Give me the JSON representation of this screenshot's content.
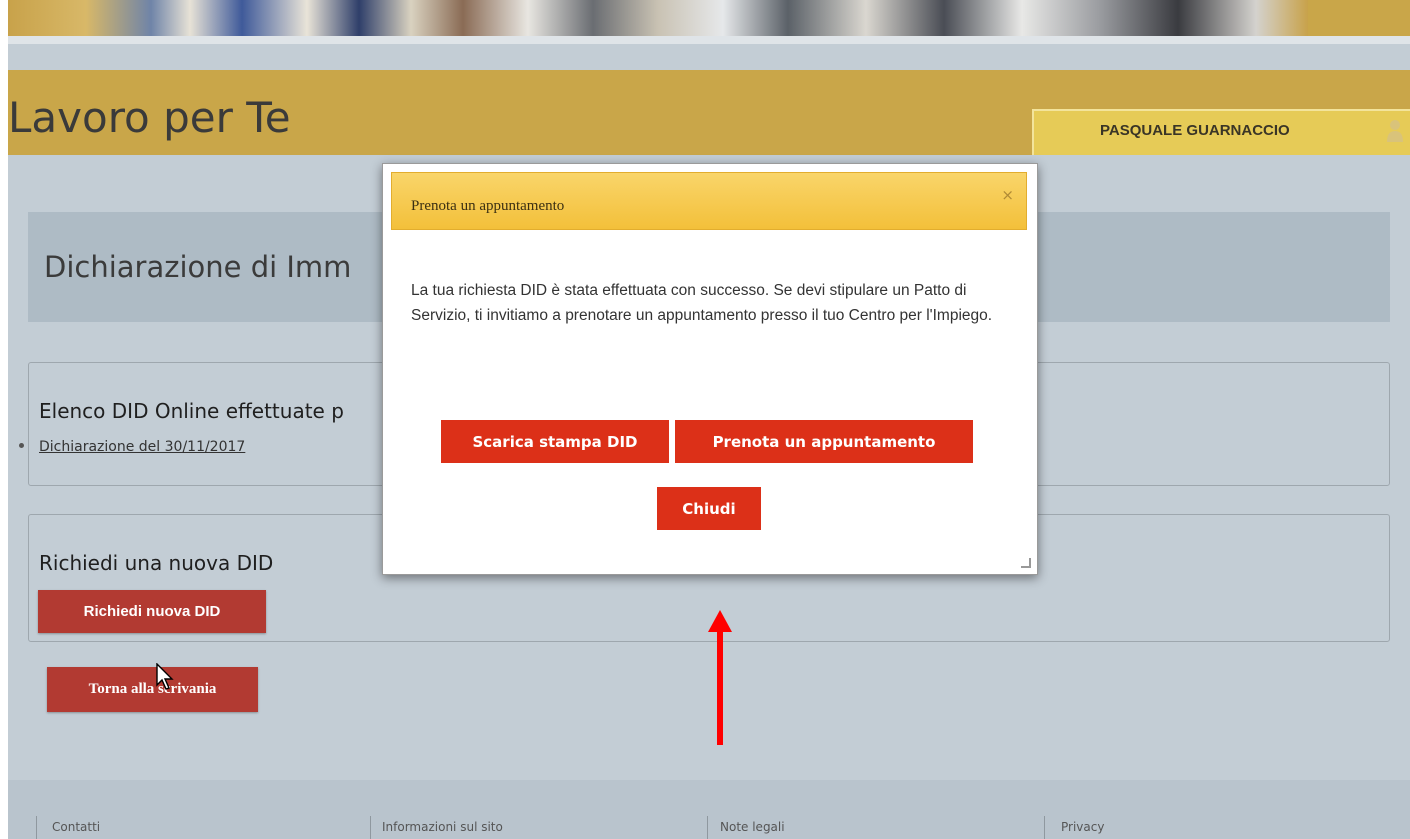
{
  "header": {
    "site_title": "Lavoro per Te",
    "user_name": "PASQUALE GUARNACCIO"
  },
  "main": {
    "page_heading": "Dichiarazione di Imm",
    "elenco_section": {
      "title": "Elenco DID Online effettuate p",
      "link": "Dichiarazione del 30/11/2017"
    },
    "new_did_section": {
      "title": "Richiedi una nuova DID",
      "button_label": "Richiedi nuova DID"
    },
    "back_button_label": "Torna alla scrivania"
  },
  "modal": {
    "title": "Prenota un appuntamento",
    "close_glyph": "×",
    "body": "La tua richiesta DID è stata effettuata con successo. Se devi stipulare un Patto di Servizio, ti invitiamo a prenotare un appuntamento presso il tuo Centro per l'Impiego.",
    "buttons": {
      "download": "Scarica stampa DID",
      "book": "Prenota un appuntamento",
      "close": "Chiudi"
    }
  },
  "footer": {
    "links": [
      "Contatti",
      "Informazioni sul sito",
      "Note legali",
      "Privacy"
    ]
  },
  "colors": {
    "gold_header": "#c9a649",
    "user_tab": "#e6cb57",
    "modal_header": "#f3c03a",
    "modal_button": "#dc3018",
    "page_button": "#b23a32",
    "annotation_arrow": "#ff0000"
  },
  "icons": {
    "user": "user-icon",
    "close": "close-icon",
    "resize": "resize-grip-icon",
    "cursor": "mouse-cursor",
    "annotation": "red-arrow-annotation"
  }
}
